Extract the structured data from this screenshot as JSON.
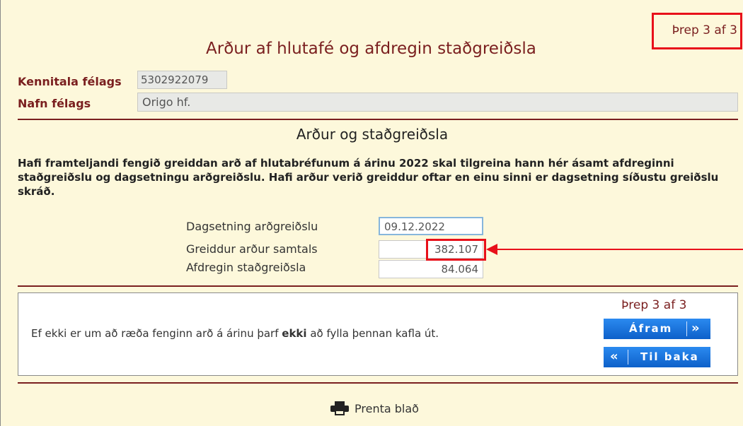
{
  "step_indicator": "Þrep 3 af 3",
  "title": "Arður af hlutafé og afdregin staðgreiðsla",
  "company": {
    "id_label": "Kennitala félags",
    "id_value": "5302922079",
    "name_label": "Nafn félags",
    "name_value": "Origo hf."
  },
  "section_title": "Arður og staðgreiðsla",
  "instructions": "Hafi framteljandi fengið greiddan arð af hlutabréfunum á árinu 2022 skal tilgreina hann hér ásamt afdreginni staðgreiðslu og dagsetningu arðgreiðslu. Hafi arður verið greiddur oftar en einu sinni er dagsetning síðustu greiðslu skráð.",
  "fields": {
    "date_label": "Dagsetning arðgreiðslu",
    "date_value": "09.12.2022",
    "total_label": "Greiddur arður samtals",
    "total_value": "382.107",
    "withholding_label": "Afdregin staðgreiðsla",
    "withholding_value": "84.064"
  },
  "footer_box": {
    "step": "Þrep 3 af 3",
    "msg_before": "Ef ekki er um að ræða fenginn arð á árinu þarf ",
    "msg_bold": "ekki",
    "msg_after": " að fylla þennan kafla út.",
    "next_label": "Áfram",
    "back_label": "Til baka"
  },
  "print_label": "Prenta blað",
  "colors": {
    "accent": "#7a1f1f",
    "highlight": "#e8101a",
    "button": "#1a73e0",
    "background": "#fdf8db"
  },
  "icons": {
    "next": "double-chevron-right-icon",
    "back": "double-chevron-left-icon",
    "print": "printer-icon"
  }
}
